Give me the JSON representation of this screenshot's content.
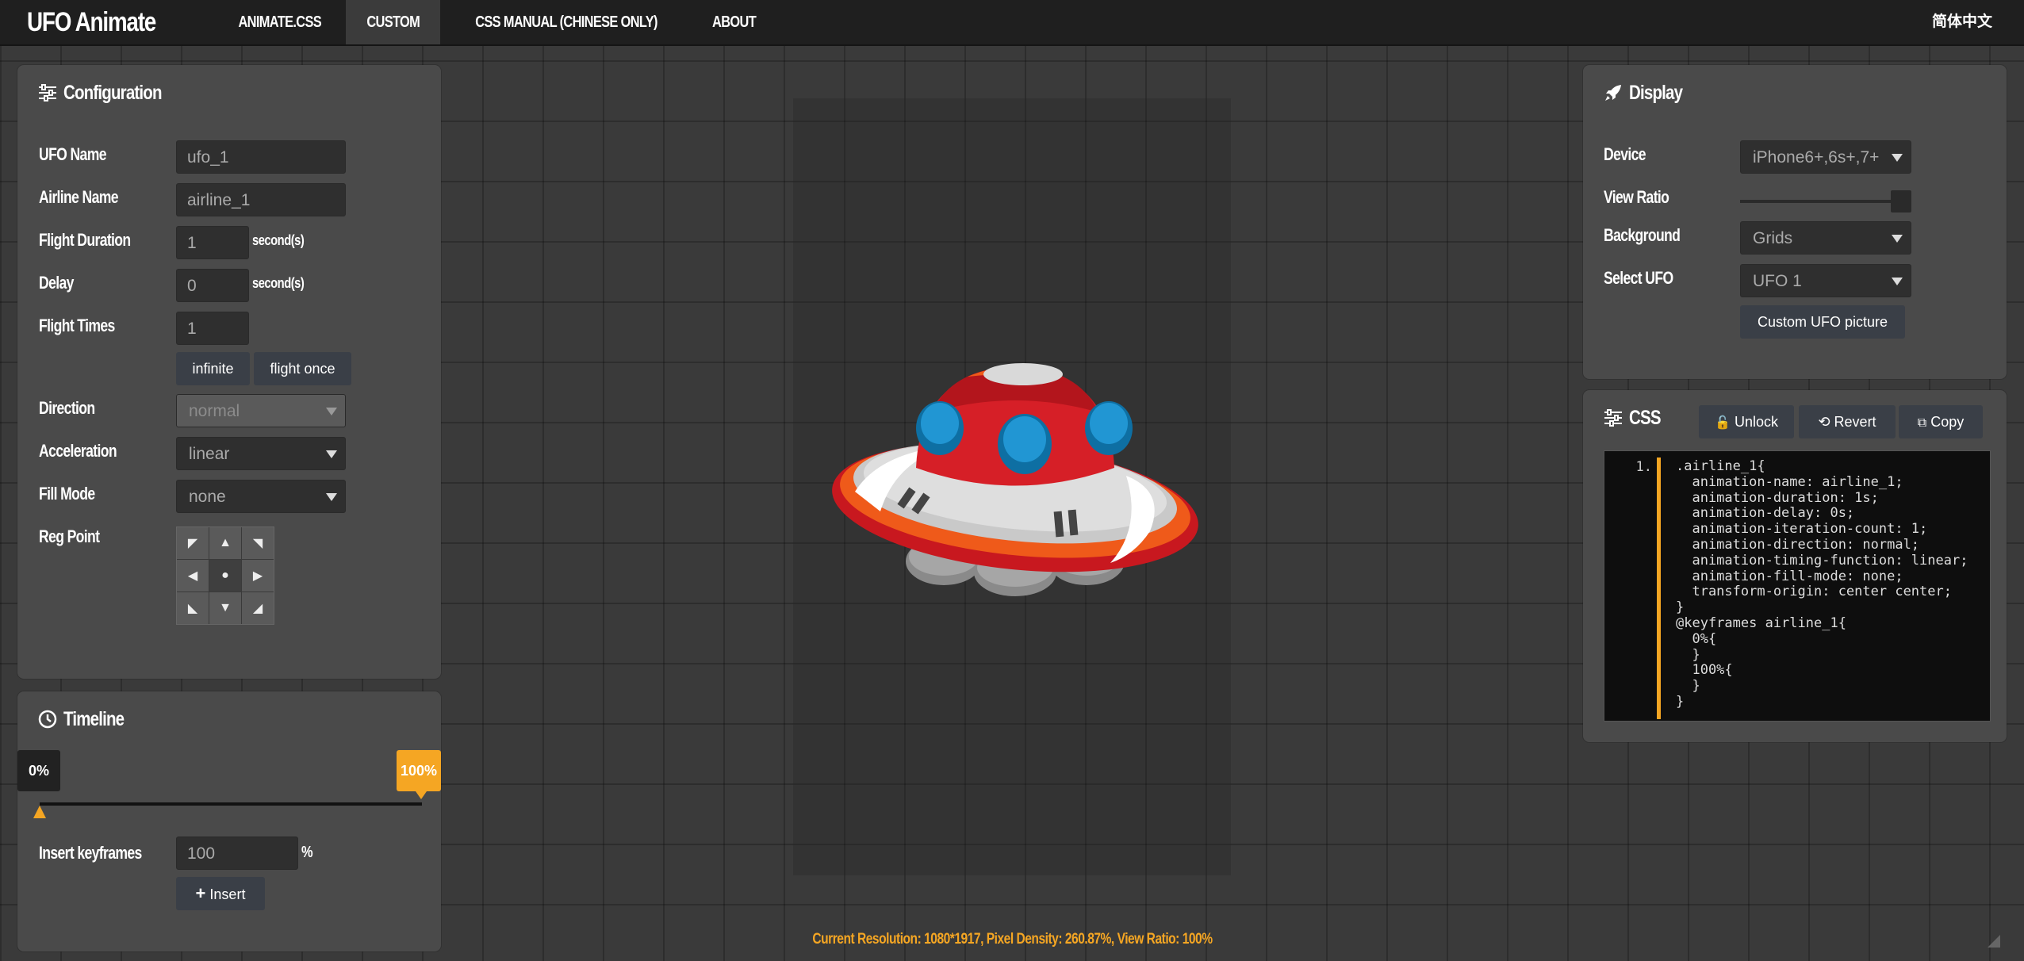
{
  "header": {
    "brand": "UFO Animate",
    "nav": [
      {
        "label": "ANIMATE.CSS",
        "active": false
      },
      {
        "label": "CUSTOM",
        "active": true
      },
      {
        "label": "CSS MANUAL (CHINESE ONLY)",
        "active": false
      },
      {
        "label": "ABOUT",
        "active": false
      }
    ],
    "language": "简体中文"
  },
  "configuration": {
    "title": "Configuration",
    "ufo_name_label": "UFO Name",
    "ufo_name_value": "ufo_1",
    "airline_name_label": "Airline Name",
    "airline_name_value": "airline_1",
    "flight_duration_label": "Flight Duration",
    "flight_duration_value": "1",
    "delay_label": "Delay",
    "delay_value": "0",
    "seconds_unit": "second(s)",
    "flight_times_label": "Flight Times",
    "flight_times_value": "1",
    "infinite_button": "infinite",
    "flight_once_button": "flight once",
    "direction_label": "Direction",
    "direction_value": "normal",
    "acceleration_label": "Acceleration",
    "acceleration_value": "linear",
    "fill_mode_label": "Fill Mode",
    "fill_mode_value": "none",
    "reg_point_label": "Reg Point",
    "reg_point_symbols": [
      "◤",
      "▲",
      "◥",
      "◀",
      "●",
      "▶",
      "◣",
      "▼",
      "◢"
    ]
  },
  "timeline": {
    "title": "Timeline",
    "start_label": "0%",
    "end_label": "100%",
    "insert_keyframes_label": "Insert keyframes",
    "insert_value": "100",
    "percent_unit": "%",
    "insert_button": "Insert"
  },
  "display": {
    "title": "Display",
    "device_label": "Device",
    "device_value": "iPhone6+,6s+,7+",
    "view_ratio_label": "View Ratio",
    "view_ratio_level": 1.0,
    "background_label": "Background",
    "background_value": "Grids",
    "select_ufo_label": "Select UFO",
    "select_ufo_value": "UFO 1",
    "custom_picture_button": "Custom UFO picture"
  },
  "css_panel": {
    "title": "CSS",
    "unlock_button": "Unlock",
    "revert_button": "Revert",
    "copy_button": "Copy",
    "line_number": "1.",
    "code": ".airline_1{\n  animation-name: airline_1;\n  animation-duration: 1s;\n  animation-delay: 0s;\n  animation-iteration-count: 1;\n  animation-direction: normal;\n  animation-timing-function: linear;\n  animation-fill-mode: none;\n  transform-origin: center center;\n}\n@keyframes airline_1{\n  0%{\n  }\n  100%{\n  }\n}"
  },
  "status": "Current Resolution: 1080*1917, Pixel Density: 260.87%, View Ratio: 100%",
  "colors": {
    "accent": "#f5a623",
    "topbar": "#1f1f1f",
    "panel": "#4a4a4a",
    "ufo_red": "#d0212b",
    "ufo_orange": "#f05a1a",
    "ufo_blue": "#1e8fc9",
    "ufo_silver": "#d8d8d8"
  }
}
